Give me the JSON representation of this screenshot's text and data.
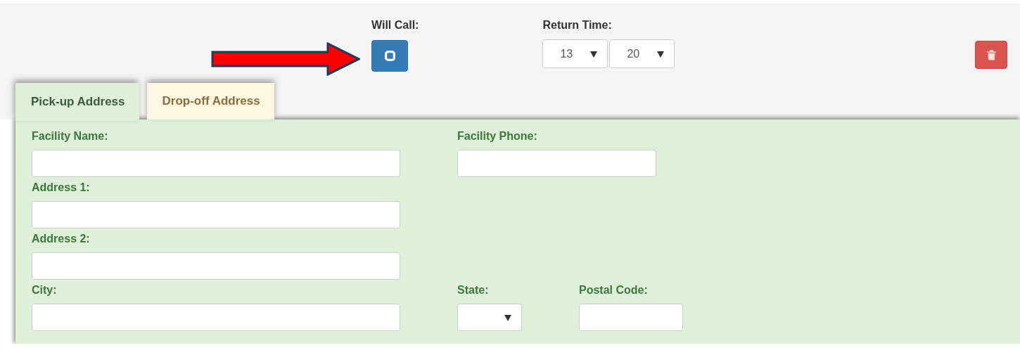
{
  "will_call": {
    "label": "Will Call:",
    "checked": false
  },
  "return_time": {
    "label": "Return Time:",
    "hour": "13",
    "minute": "20"
  },
  "tabs": [
    {
      "label": "Pick-up Address",
      "selected": true
    },
    {
      "label": "Drop-off Address",
      "selected": false
    }
  ],
  "form_rows": [
    {
      "fields": [
        {
          "label": "Facility Name:",
          "kind": "text"
        },
        {
          "label": "Facility Phone:",
          "kind": "text"
        }
      ]
    },
    {
      "fields": [
        {
          "label": "Address 1:",
          "kind": "text"
        }
      ]
    },
    {
      "fields": [
        {
          "label": "Address 2:",
          "kind": "text"
        }
      ]
    },
    {
      "fields": [
        {
          "label": "City:",
          "kind": "text"
        },
        {
          "label": "State:",
          "kind": "select"
        },
        {
          "label": "Postal Code:",
          "kind": "text"
        }
      ]
    }
  ]
}
